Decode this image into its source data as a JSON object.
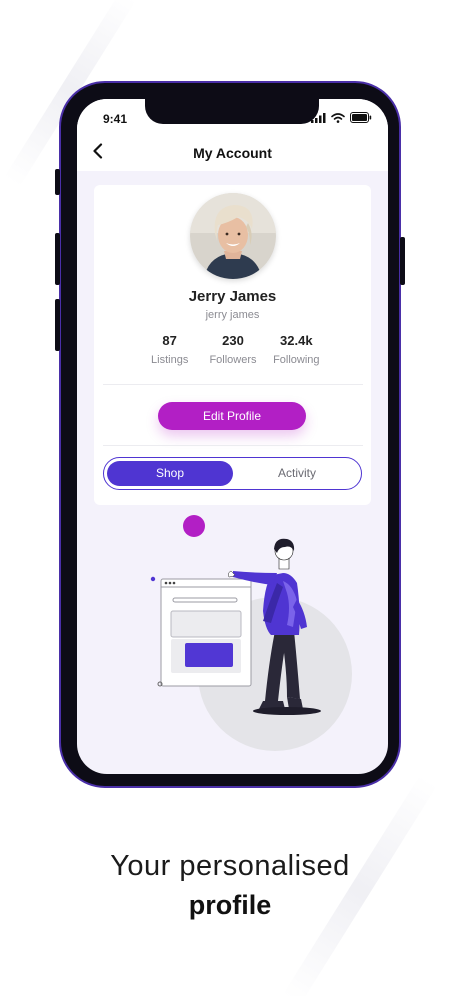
{
  "status_bar": {
    "time": "9:41"
  },
  "nav": {
    "title": "My Account",
    "back_icon": "chevron-left-icon"
  },
  "profile": {
    "name": "Jerry James",
    "username": "jerry james",
    "stats": [
      {
        "value": "87",
        "label": "Listings"
      },
      {
        "value": "230",
        "label": "Followers"
      },
      {
        "value": "32.4k",
        "label": "Following"
      }
    ],
    "edit_label": "Edit Profile"
  },
  "tabs": {
    "shop": "Shop",
    "activity": "Activity",
    "selected": "Shop"
  },
  "caption": {
    "line1": "Your personalised",
    "line2": "profile"
  },
  "colors": {
    "primary": "#4f35d2",
    "accent": "#b21fc5",
    "screen_bg": "#f4f2fb"
  }
}
